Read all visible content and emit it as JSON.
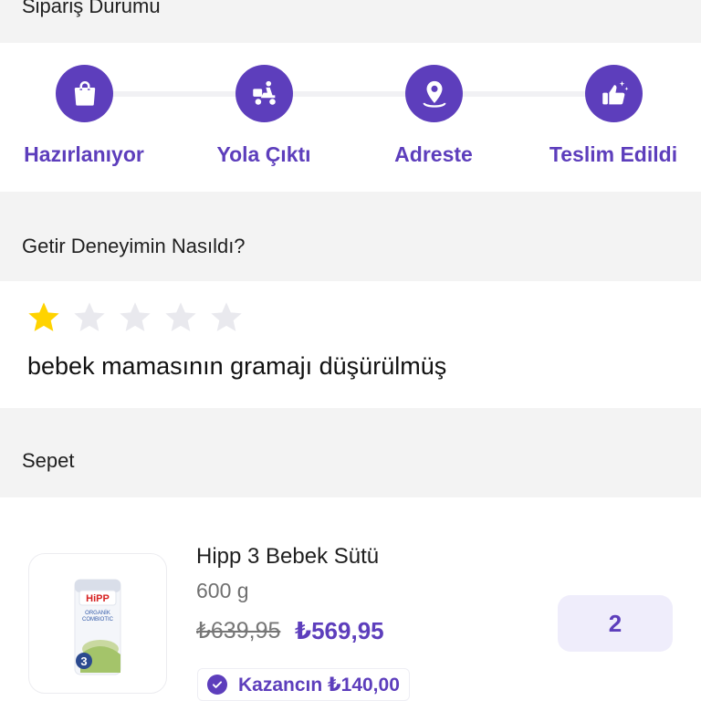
{
  "status_section": {
    "title": "Sipariş Durumu",
    "steps": [
      {
        "label": "Hazırlanıyor",
        "icon": "shopping-bag-icon"
      },
      {
        "label": "Yola Çıktı",
        "icon": "courier-scooter-icon"
      },
      {
        "label": "Adreste",
        "icon": "location-pin-icon"
      },
      {
        "label": "Teslim Edildi",
        "icon": "thumbs-up-sparkle-icon"
      }
    ]
  },
  "rating_section": {
    "title": "Getir Deneyimin Nasıldı?",
    "rating": 1,
    "max_rating": 5,
    "review": "bebek mamasının gramajı düşürülmüş"
  },
  "cart_section": {
    "title": "Sepet",
    "product": {
      "name": "Hipp 3 Bebek Sütü",
      "weight": "600 g",
      "old_price": "₺639,95",
      "new_price": "₺569,95",
      "savings": "Kazancın ₺140,00",
      "quantity": "2"
    }
  },
  "colors": {
    "accent": "#5d3ebc",
    "star_filled": "#ffd300",
    "star_empty": "#e9e9ee",
    "section_bg": "#f3f3f3"
  }
}
